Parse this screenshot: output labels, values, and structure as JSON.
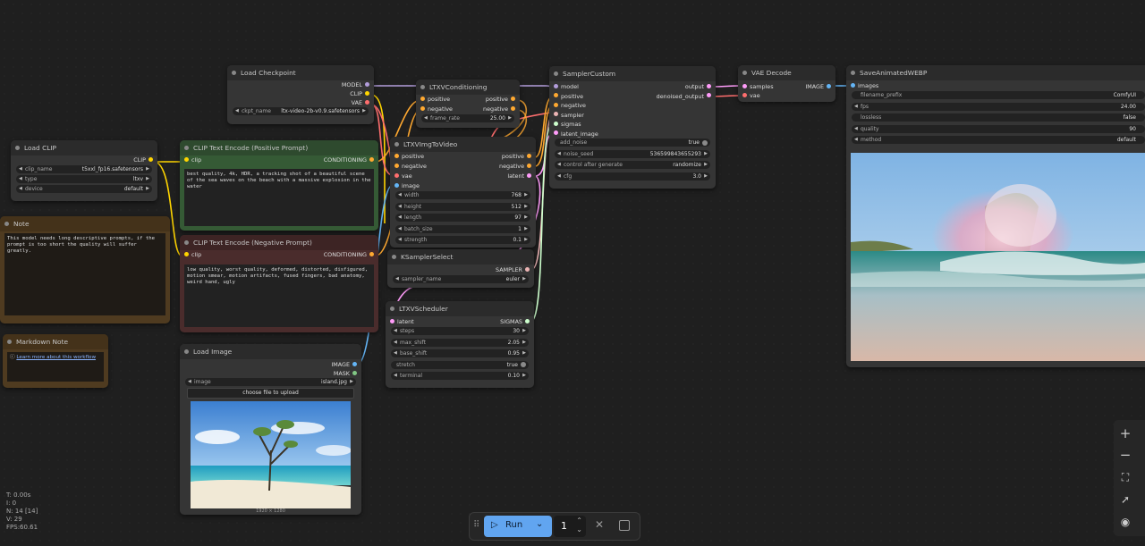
{
  "colors": {
    "model": "#b39ddb",
    "clip": "#ffd500",
    "vae": "#ff6e6e",
    "conditioning": "#ffa931",
    "latent": "#ff9cf9",
    "image": "#64b5f6",
    "sampler": "#ecb4b4",
    "sigmas": "#cdffcd",
    "int": "#aaa"
  },
  "nodes": {
    "load_clip": {
      "title": "Load CLIP",
      "out_clip": "CLIP",
      "w_clip_name_l": "clip_name",
      "w_clip_name_v": "t5xxl_fp16.safetensors",
      "w_type_l": "type",
      "w_type_v": "ltxv",
      "w_device_l": "device",
      "w_device_v": "default"
    },
    "note": {
      "title": "Note",
      "text": "This model needs long descriptive prompts, if the prompt is too short the quality will suffer greatly."
    },
    "md_note": {
      "title": "Markdown Note",
      "link": "Learn more about this workflow"
    },
    "load_ckpt": {
      "title": "Load Checkpoint",
      "out_model": "MODEL",
      "out_clip": "CLIP",
      "out_vae": "VAE",
      "w_l": "ckpt_name",
      "w_v": "ltx-video-2b-v0.9.safetensors"
    },
    "clip_pos": {
      "title": "CLIP Text Encode (Positive Prompt)",
      "in_clip": "clip",
      "out": "CONDITIONING",
      "text": "best quality, 4k, HDR, a tracking shot of a beautiful scene of the sea waves on the beach with a massive explosion in the water"
    },
    "clip_neg": {
      "title": "CLIP Text Encode (Negative Prompt)",
      "in_clip": "clip",
      "out": "CONDITIONING",
      "text": "low quality, worst quality, deformed, distorted, disfigured, motion smear, motion artifacts, fused fingers, bad anatomy, weird hand, ugly"
    },
    "load_image": {
      "title": "Load Image",
      "out_image": "IMAGE",
      "out_mask": "MASK",
      "w_l": "image",
      "w_v": "island.jpg",
      "upload": "choose file to upload",
      "dims": "1920 × 1280"
    },
    "ltxv_cond": {
      "title": "LTXVConditioning",
      "in_pos": "positive",
      "in_neg": "negative",
      "out_pos": "positive",
      "out_neg": "negative",
      "w_l": "frame_rate",
      "w_v": "25.00"
    },
    "img2vid": {
      "title": "LTXVImgToVideo",
      "in_pos": "positive",
      "in_neg": "negative",
      "in_vae": "vae",
      "in_image": "image",
      "out_pos": "positive",
      "out_neg": "negative",
      "out_latent": "latent",
      "widgets": [
        {
          "l": "width",
          "v": "768"
        },
        {
          "l": "height",
          "v": "512"
        },
        {
          "l": "length",
          "v": "97"
        },
        {
          "l": "batch_size",
          "v": "1"
        },
        {
          "l": "strength",
          "v": "0.1"
        }
      ]
    },
    "ksampler_select": {
      "title": "KSamplerSelect",
      "out": "SAMPLER",
      "w_l": "sampler_name",
      "w_v": "euler"
    },
    "scheduler": {
      "title": "LTXVScheduler",
      "in_latent": "latent",
      "out": "SIGMAS",
      "widgets": [
        {
          "l": "steps",
          "v": "30"
        },
        {
          "l": "max_shift",
          "v": "2.05"
        },
        {
          "l": "base_shift",
          "v": "0.95"
        }
      ],
      "stretch_l": "stretch",
      "stretch_v": "true",
      "terminal_l": "terminal",
      "terminal_v": "0.10"
    },
    "sampler_custom": {
      "title": "SamplerCustom",
      "in_model": "model",
      "in_pos": "positive",
      "in_neg": "negative",
      "in_sampler": "sampler",
      "in_sigmas": "sigmas",
      "in_latent": "latent_image",
      "out_output": "output",
      "out_denoised": "denoised_output",
      "add_noise_l": "add_noise",
      "add_noise_v": "true",
      "seed_l": "noise_seed",
      "seed_v": "536599843655293",
      "ctrl_l": "control after generate",
      "ctrl_v": "randomize",
      "cfg_l": "cfg",
      "cfg_v": "3.0"
    },
    "vae_decode": {
      "title": "VAE Decode",
      "in_samples": "samples",
      "in_vae": "vae",
      "out": "IMAGE"
    },
    "save_webp": {
      "title": "SaveAnimatedWEBP",
      "in_images": "images",
      "widgets": [
        {
          "l": "filename_prefix",
          "v": "ComfyUI"
        },
        {
          "l": "fps",
          "v": "24.00"
        },
        {
          "l": "lossless",
          "v": "false"
        },
        {
          "l": "quality",
          "v": "90"
        },
        {
          "l": "method",
          "v": "default"
        }
      ]
    }
  },
  "stats": {
    "t": "T: 0.00s",
    "i": "I: 0",
    "n": "N: 14 [14]",
    "v": "V: 29",
    "fps": "FPS:60.61"
  },
  "runbar": {
    "run_label": "Run",
    "batch_count": "1"
  }
}
